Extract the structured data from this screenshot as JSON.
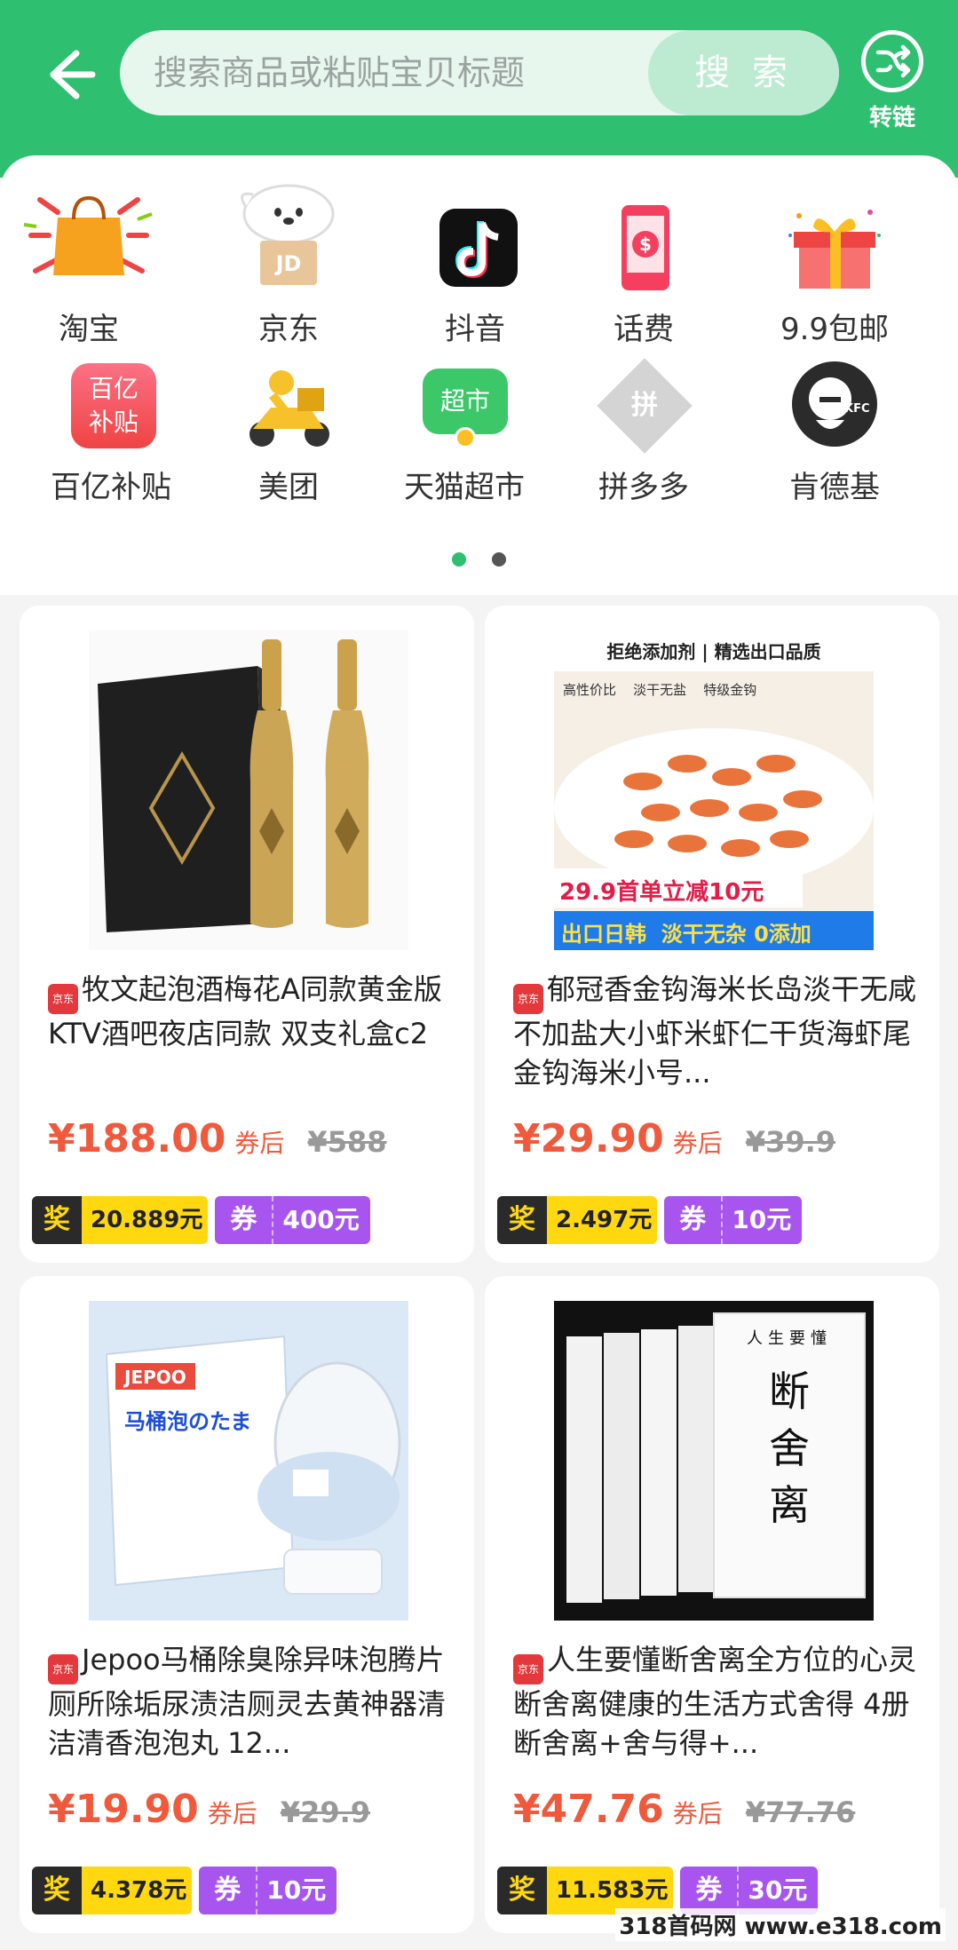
{
  "header": {
    "search_placeholder": "搜索商品或粘贴宝贝标题",
    "search_button": "搜 索",
    "convert_label": "转链",
    "bg_color": "#2ec070"
  },
  "categories": [
    {
      "label": "淘宝",
      "icon": "taobao-icon"
    },
    {
      "label": "京东",
      "icon": "jd-icon"
    },
    {
      "label": "抖音",
      "icon": "douyin-icon"
    },
    {
      "label": "话费",
      "icon": "phone-bill-icon"
    },
    {
      "label": "9.9包邮",
      "icon": "gift-icon"
    },
    {
      "label": "百亿补贴",
      "icon": "subsidy-icon",
      "icon_text": "百亿\n补贴"
    },
    {
      "label": "美团",
      "icon": "meituan-icon"
    },
    {
      "label": "天猫超市",
      "icon": "tmall-market-icon",
      "icon_text": "超市"
    },
    {
      "label": "拼多多",
      "icon": "pinduoduo-icon",
      "icon_text": "拼"
    },
    {
      "label": "肯德基",
      "icon": "kfc-icon",
      "icon_text": "KFC"
    }
  ],
  "pager": {
    "active": 1,
    "total": 2
  },
  "products": [
    {
      "title": "牧文起泡酒梅花A同款黄金版KTV酒吧夜店同款 双支礼盒c2",
      "source_tag": "京东",
      "price": "¥188.00",
      "after_label": "券后",
      "original_price": "¥588",
      "reward_key": "奖",
      "reward": "20.889元",
      "coupon_key": "券",
      "coupon": "400元"
    },
    {
      "title": "郁冠香金钩海米长岛淡干无咸不加盐大小虾米虾仁干货海虾尾 金钩海米小号...",
      "source_tag": "京东",
      "price": "¥29.90",
      "after_label": "券后",
      "original_price": "¥39.9",
      "reward_key": "奖",
      "reward": "2.497元",
      "coupon_key": "券",
      "coupon": "10元",
      "image_texts": {
        "banner": "拒绝添加剂 | 精选出口品质",
        "f1": "高性价比",
        "f2": "淡干无盐",
        "f3": "特级金钩",
        "promo": "29.9首单立减10元",
        "bottom": "出口日韩  淡干无杂 0添加"
      }
    },
    {
      "title": "Jepoo马桶除臭除异味泡腾片厕所除垢尿渍洁厕灵去黄神器清洁清香泡泡丸 12...",
      "source_tag": "京东",
      "price": "¥19.90",
      "after_label": "券后",
      "original_price": "¥29.9",
      "reward_key": "奖",
      "reward": "4.378元",
      "coupon_key": "券",
      "coupon": "10元",
      "image_texts": {
        "brand": "JEPOO",
        "name": "马桶泡のたま"
      }
    },
    {
      "title": "人生要懂断舍离全方位的心灵断舍离健康的生活方式舍得 4册断舍离+舍与得+...",
      "source_tag": "京东",
      "price": "¥47.76",
      "after_label": "券后",
      "original_price": "¥77.76",
      "reward_key": "奖",
      "reward": "11.583元",
      "coupon_key": "券",
      "coupon": "30元",
      "image_texts": {
        "top": "人生要懂",
        "main": "断舍离"
      }
    }
  ],
  "watermark": "318首码网  www.e318.com"
}
